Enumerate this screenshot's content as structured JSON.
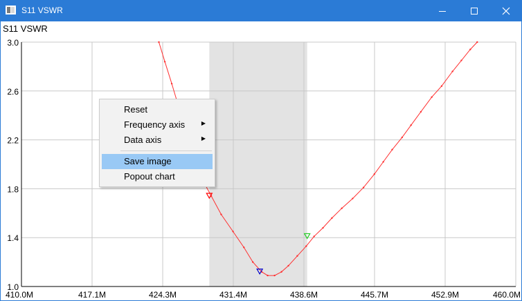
{
  "window": {
    "title": "S11 VSWR",
    "icon": "app-window-icon"
  },
  "chart_data": {
    "type": "line",
    "title": "S11  VSWR",
    "xlabel": "",
    "ylabel": "",
    "xlim": [
      410.0,
      460.0
    ],
    "ylim": [
      1.0,
      3.0
    ],
    "grid": true,
    "x_tick_labels": [
      "410.0M",
      "417.1M",
      "424.3M",
      "431.4M",
      "438.6M",
      "445.7M",
      "452.9M",
      "460.0M"
    ],
    "y_tick_labels": [
      "1.0",
      "1.4",
      "1.8",
      "2.2",
      "2.6",
      "3.0"
    ],
    "series": [
      {
        "color": "#ff3030",
        "x": [
          423.9,
          424.5,
          425.2,
          425.9,
          426.6,
          427.4,
          428.2,
          429.2,
          430.2,
          431.4,
          432.5,
          433.4,
          434.3,
          434.9,
          435.6,
          436.3,
          437.0,
          437.9,
          438.8,
          439.6,
          440.5,
          441.4,
          442.4,
          443.5,
          444.6,
          445.7,
          446.6,
          447.5,
          448.5,
          449.4,
          450.4,
          451.5,
          452.5,
          453.6,
          454.5,
          455.4,
          456.1
        ],
        "y": [
          3.0,
          2.84,
          2.66,
          2.47,
          2.27,
          2.07,
          1.89,
          1.74,
          1.59,
          1.45,
          1.32,
          1.2,
          1.12,
          1.09,
          1.09,
          1.12,
          1.17,
          1.25,
          1.33,
          1.41,
          1.48,
          1.56,
          1.64,
          1.72,
          1.81,
          1.92,
          2.02,
          2.12,
          2.22,
          2.32,
          2.43,
          2.55,
          2.64,
          2.76,
          2.85,
          2.94,
          3.0
        ]
      }
    ],
    "highlight_range": {
      "x_start": 429.0,
      "x_end": 438.9,
      "color": "#e3e3e3"
    },
    "markers": [
      {
        "x": 429.0,
        "y": 1.74,
        "color": "#ff0000"
      },
      {
        "x": 434.1,
        "y": 1.12,
        "color": "#0000cc"
      },
      {
        "x": 438.9,
        "y": 1.41,
        "color": "#22cc22"
      }
    ]
  },
  "context_menu": {
    "items": [
      {
        "label": "Reset",
        "submenu": false,
        "highlighted": false
      },
      {
        "label": "Frequency axis",
        "submenu": true,
        "highlighted": false
      },
      {
        "label": "Data axis",
        "submenu": true,
        "highlighted": false
      },
      {
        "label": "Save image",
        "submenu": false,
        "highlighted": true
      },
      {
        "label": "Popout chart",
        "submenu": false,
        "highlighted": false
      }
    ]
  }
}
